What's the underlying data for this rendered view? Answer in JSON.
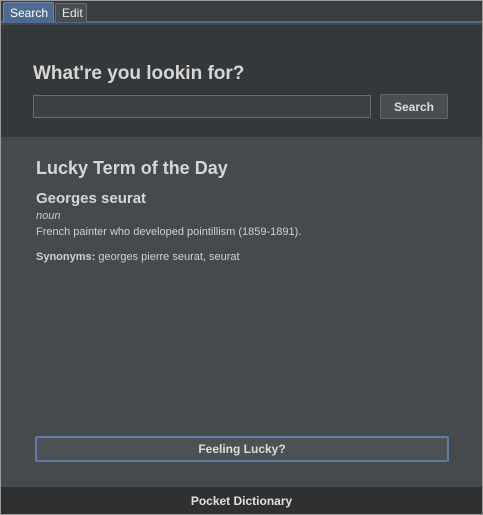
{
  "tabs": {
    "search": "Search",
    "edit": "Edit"
  },
  "search": {
    "heading": "What're you lookin for?",
    "input_value": "",
    "button_label": "Search"
  },
  "lucky": {
    "heading": "Lucky Term of the Day",
    "word": "Georges seurat",
    "part_of_speech": "noun",
    "definition": "French painter who developed pointillism (1859-1891).",
    "synonyms_label": "Synonyms:",
    "synonyms": "georges pierre seurat, seurat",
    "button_label": "Feeling Lucky?"
  },
  "footer": {
    "app_name": "Pocket Dictionary"
  },
  "colors": {
    "accent": "#4f6a8f",
    "panel": "#464a4c",
    "header_band": "#35383a",
    "footer": "#2e3032"
  }
}
